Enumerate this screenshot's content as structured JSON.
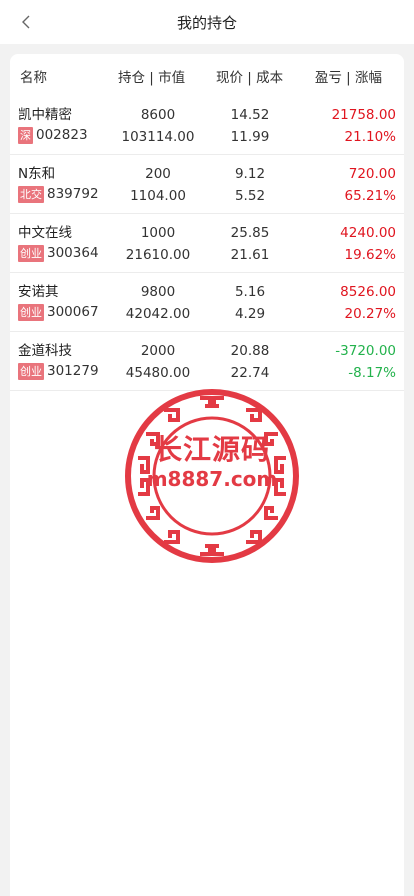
{
  "header": {
    "title": "我的持仓",
    "back_icon": "chevron-left-icon"
  },
  "table": {
    "headers": [
      "名称",
      "持仓 | 市值",
      "现价 | 成本",
      "盈亏 | 涨幅"
    ],
    "rows": [
      {
        "name": "凯中精密",
        "tag": "深",
        "code": "002823",
        "shares": "8600",
        "market_value": "103114.00",
        "price": "14.52",
        "cost": "11.99",
        "pnl": "21758.00",
        "change": "21.10%",
        "status": "up"
      },
      {
        "name": "N东和",
        "tag": "北交",
        "code": "839792",
        "shares": "200",
        "market_value": "1104.00",
        "price": "9.12",
        "cost": "5.52",
        "pnl": "720.00",
        "change": "65.21%",
        "status": "up"
      },
      {
        "name": "中文在线",
        "tag": "创业",
        "code": "300364",
        "shares": "1000",
        "market_value": "21610.00",
        "price": "25.85",
        "cost": "21.61",
        "pnl": "4240.00",
        "change": "19.62%",
        "status": "up"
      },
      {
        "name": "安诺其",
        "tag": "创业",
        "code": "300067",
        "shares": "9800",
        "market_value": "42042.00",
        "price": "5.16",
        "cost": "4.29",
        "pnl": "8526.00",
        "change": "20.27%",
        "status": "up"
      },
      {
        "name": "金道科技",
        "tag": "创业",
        "code": "301279",
        "shares": "2000",
        "market_value": "45480.00",
        "price": "20.88",
        "cost": "22.74",
        "pnl": "-3720.00",
        "change": "-8.17%",
        "status": "down"
      }
    ]
  },
  "watermark": {
    "line1": "长江源码",
    "line2": "m8887.com"
  },
  "colors": {
    "up": "#e0151f",
    "down": "#23b24c",
    "tag_bg": "#e9747c",
    "watermark": "#e33a44"
  }
}
